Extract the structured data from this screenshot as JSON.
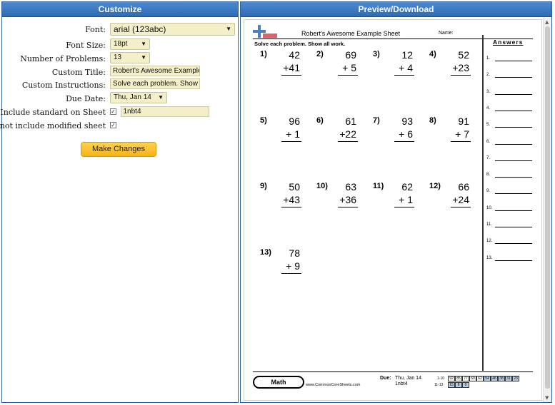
{
  "left_panel": {
    "title": "Customize",
    "fields": {
      "font_label": "Font:",
      "font_value": "arial (123abc)",
      "font_size_label": "Font Size:",
      "font_size_value": "18pt",
      "num_problems_label": "Number of Problems:",
      "num_problems_value": "13",
      "custom_title_label": "Custom Title:",
      "custom_title_value": "Robert's Awesome Example",
      "custom_instr_label": "Custom Instructions:",
      "custom_instr_value": "Solve each problem. Show a",
      "due_date_label": "Due Date:",
      "due_date_value": "Thu, Jan 14",
      "standard_label": "Include standard on Sheet",
      "standard_value": "1nbt4",
      "modified_label": "Do not include modified sheet"
    },
    "button": "Make Changes"
  },
  "right_panel": {
    "title": "Preview/Download",
    "sheet": {
      "title": "Robert's Awesome Example Sheet",
      "name_label": "Name:",
      "instructions": "Solve each problem. Show all work.",
      "answers_header": "Answers",
      "problems": [
        {
          "n": "1)",
          "a": "42",
          "b": "+41"
        },
        {
          "n": "2)",
          "a": "69",
          "b": "+ 5"
        },
        {
          "n": "3)",
          "a": "12",
          "b": "+ 4"
        },
        {
          "n": "4)",
          "a": "52",
          "b": "+23"
        },
        {
          "n": "5)",
          "a": "96",
          "b": "+ 1"
        },
        {
          "n": "6)",
          "a": "61",
          "b": "+22"
        },
        {
          "n": "7)",
          "a": "93",
          "b": "+ 6"
        },
        {
          "n": "8)",
          "a": "91",
          "b": "+ 7"
        },
        {
          "n": "9)",
          "a": "50",
          "b": "+43"
        },
        {
          "n": "10)",
          "a": "63",
          "b": "+36"
        },
        {
          "n": "11)",
          "a": "62",
          "b": "+ 1"
        },
        {
          "n": "12)",
          "a": "66",
          "b": "+24"
        },
        {
          "n": "13)",
          "a": "78",
          "b": "+ 9"
        }
      ],
      "answer_numbers": [
        "1.",
        "2.",
        "3.",
        "4.",
        "5.",
        "6.",
        "7.",
        "8.",
        "9.",
        "10.",
        "11.",
        "12.",
        "13."
      ],
      "footer": {
        "subject": "Math",
        "site": "www.CommonCoreSheets.com",
        "due_label": "Due:",
        "due_value": "Thu, Jan 14",
        "standard": "1nbt4",
        "range1": "1-10",
        "range2": "11-13",
        "scores1": [
          "92",
          "85",
          "77",
          "69",
          "62",
          "54",
          "46",
          "38",
          "31",
          "23"
        ],
        "scores2": [
          "15",
          "8",
          "0"
        ]
      }
    }
  },
  "colors": {
    "header_blue": "#2f6bb4",
    "input_bg": "#f3efc8",
    "button_orange": "#f7b21b"
  }
}
